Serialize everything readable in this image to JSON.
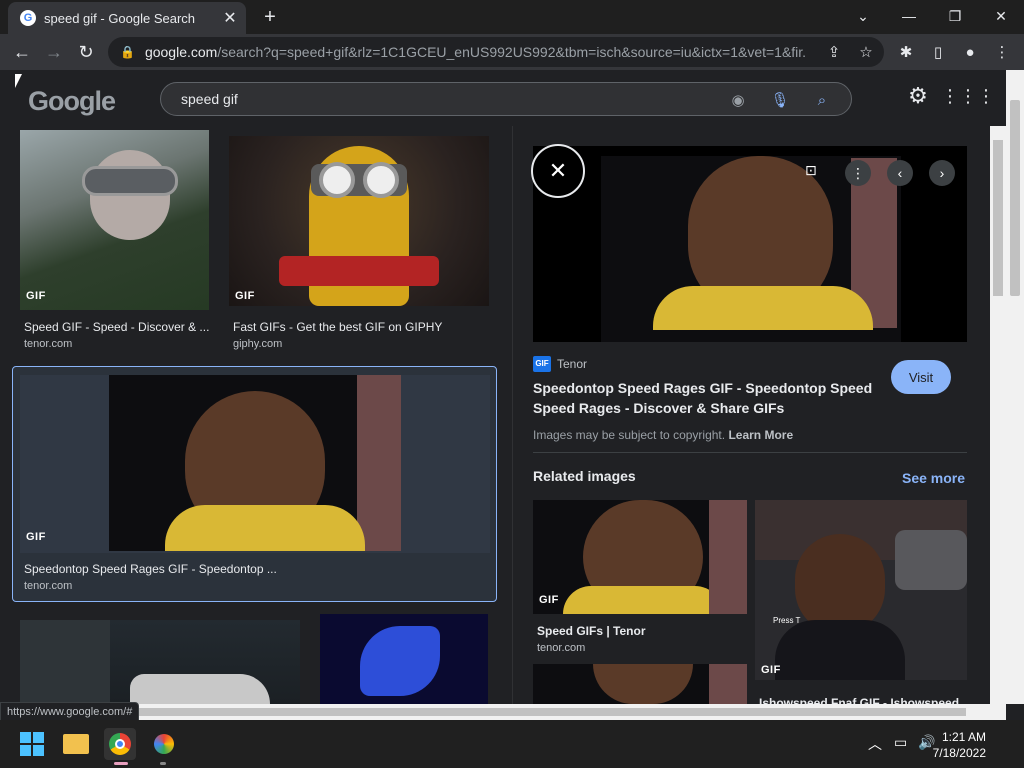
{
  "browser": {
    "tab_title": "speed gif - Google Search",
    "url_host": "google.com",
    "url_path": "/search?q=speed+gif&rlz=1C1GCEU_enUS992US992&tbm=isch&source=iu&ictx=1&vet=1&fir...",
    "status_url": "https://www.google.com/#"
  },
  "google": {
    "logo_text": "Google",
    "search_query": "speed gif"
  },
  "results": [
    {
      "title": "Speed GIF - Speed - Discover & ...",
      "source": "tenor.com",
      "badge": "GIF"
    },
    {
      "title": "Fast GIFs - Get the best GIF on GIPHY",
      "source": "giphy.com",
      "badge": "GIF"
    },
    {
      "title": "Speedontop Speed Rages GIF - Speedontop ...",
      "source": "tenor.com",
      "badge": "GIF"
    }
  ],
  "preview": {
    "source_badge": "GIF",
    "source_name": "Tenor",
    "title": "Speedontop Speed Rages GIF - Speedontop Speed Speed Rages - Discover & Share GIFs",
    "visit_label": "Visit",
    "copyright_text": "Images may be subject to copyright.",
    "learn_more": "Learn More",
    "related_heading": "Related images",
    "see_more": "See more",
    "related": [
      {
        "title": "Speed GIFs | Tenor",
        "source": "tenor.com",
        "badge": "GIF"
      },
      {
        "title": "Ishowspeed Fnaf GIF - Ishowspeed ...",
        "badge": "GIF",
        "overlay": "Press T"
      }
    ]
  },
  "taskbar": {
    "time": "1:21 AM",
    "date": "7/18/2022"
  }
}
